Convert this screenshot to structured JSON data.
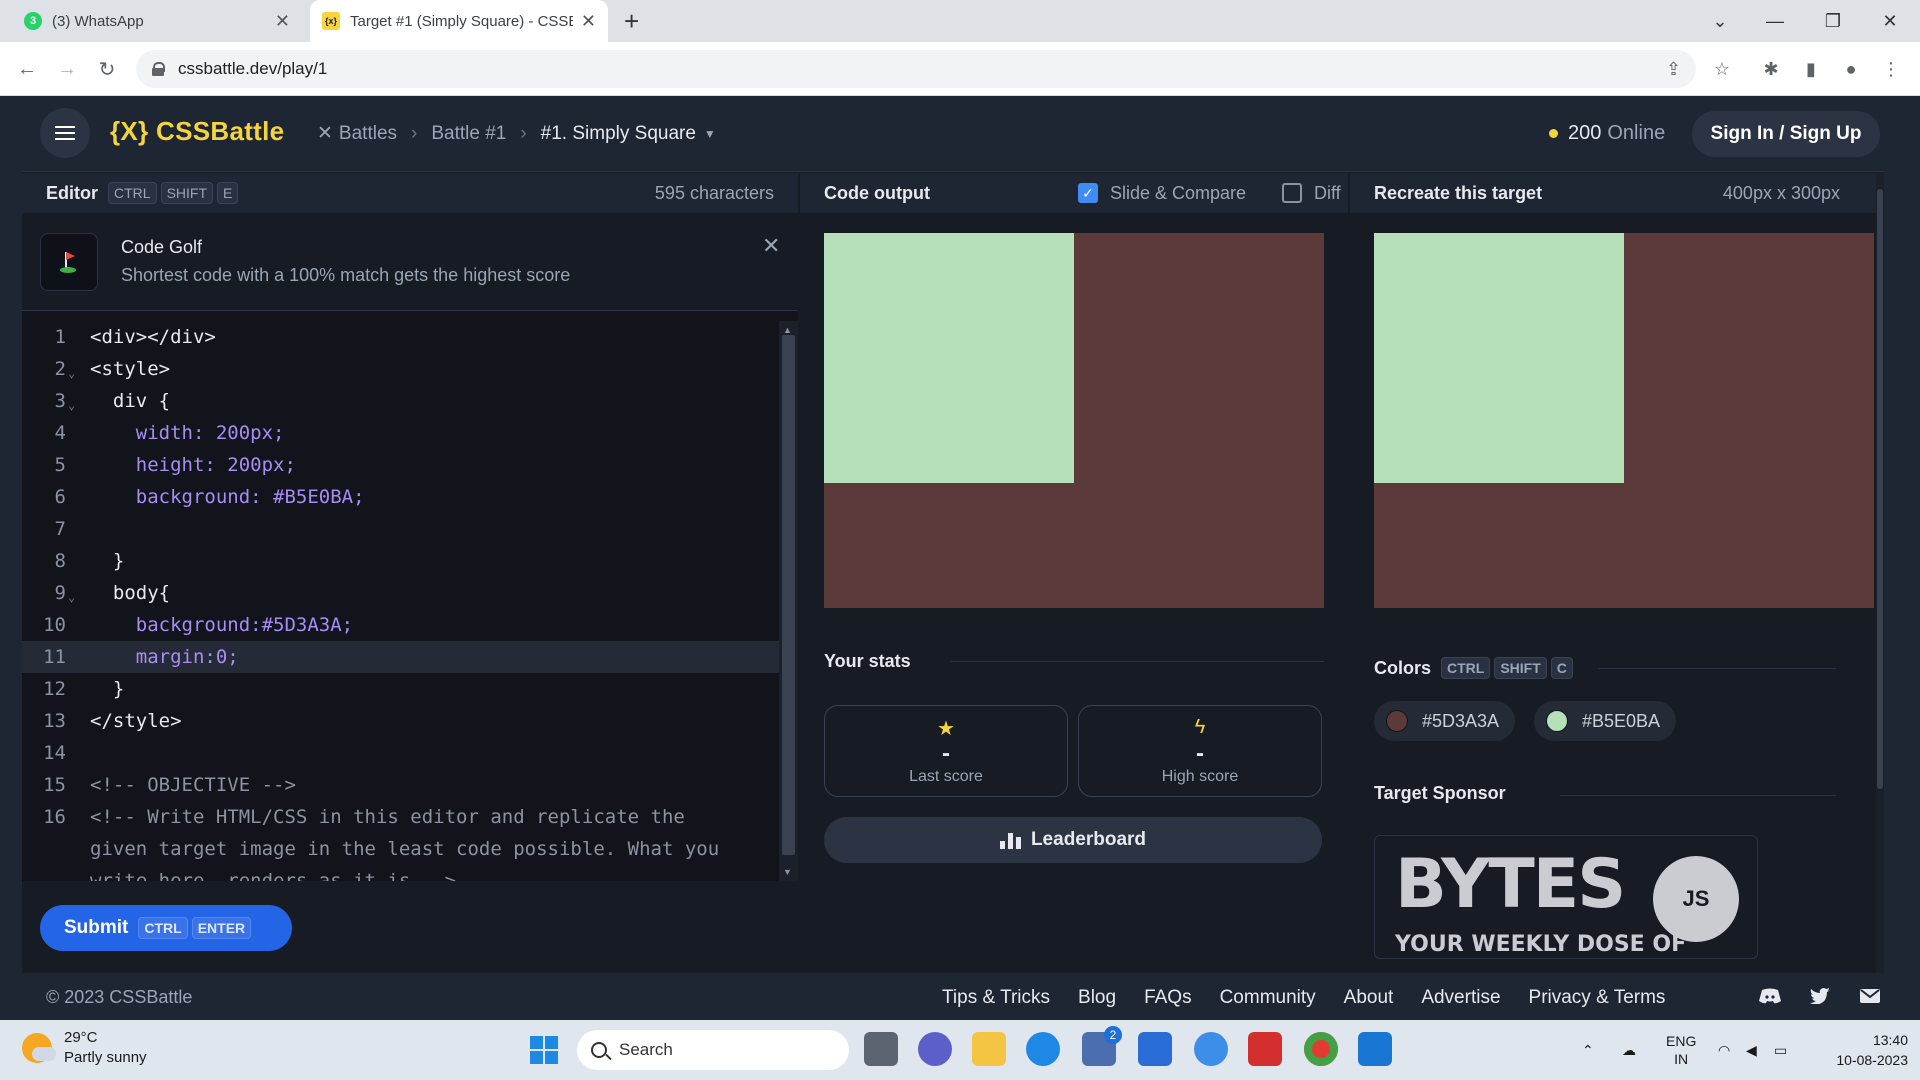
{
  "browser": {
    "tabs": [
      {
        "label": "(3) WhatsApp",
        "favicon_text": "3",
        "active": false
      },
      {
        "label": "Target #1 (Simply Square) - CSSB",
        "favicon_text": "{x}",
        "active": true
      }
    ],
    "new_tab": "+",
    "url": "cssbattle.dev/play/1"
  },
  "header": {
    "logo": "{X} CSSBattle",
    "breadcrumbs": [
      "Battles",
      "Battle #1",
      "#1. Simply Square"
    ],
    "online_count": "200",
    "online_label": "Online",
    "signin": "Sign In / Sign Up"
  },
  "editor": {
    "title": "Editor",
    "shortcut": [
      "CTRL",
      "SHIFT",
      "E"
    ],
    "chars": "595 characters",
    "golf_title": "Code Golf",
    "golf_desc": "Shortest code with a 100% match gets the highest score",
    "lines": [
      "<div></div>",
      "<style>",
      "  div {",
      "    width: 200px;",
      "    height: 200px;",
      "    background: #B5E0BA;",
      "",
      "  }",
      "  body{",
      "    background:#5D3A3A;",
      "    margin:0;",
      "  }",
      "</style>",
      "",
      "<!-- OBJECTIVE -->",
      "<!-- Write HTML/CSS in this editor and replicate the",
      "given target image in the least code possible. What you",
      "write here, renders as it is -->"
    ],
    "highlighted_line": 11,
    "submit": "Submit",
    "submit_shortcut": [
      "CTRL",
      "ENTER"
    ]
  },
  "output": {
    "title": "Code output",
    "slide_compare": "Slide & Compare",
    "slide_checked": true,
    "diff": "Diff",
    "diff_checked": false,
    "stats_title": "Your stats",
    "last_score_value": "-",
    "last_score_label": "Last score",
    "high_score_value": "-",
    "high_score_label": "High score",
    "leaderboard": "Leaderboard"
  },
  "target": {
    "title": "Recreate this target",
    "dimensions": "400px x 300px",
    "colors_title": "Colors",
    "colors_shortcut": [
      "CTRL",
      "SHIFT",
      "C"
    ],
    "colors": [
      {
        "hex": "#5D3A3A",
        "label": "#5D3A3A"
      },
      {
        "hex": "#B5E0BA",
        "label": "#B5E0BA"
      }
    ],
    "sponsor_title": "Target Sponsor",
    "sponsor_text_big": "BYTES",
    "sponsor_text_small": "YOUR WEEKLY DOSE OF",
    "sponsor_badge": "JS"
  },
  "footer": {
    "copyright": "© 2023 CSSBattle",
    "links": [
      "Tips & Tricks",
      "Blog",
      "FAQs",
      "Community",
      "About",
      "Advertise",
      "Privacy & Terms"
    ]
  },
  "taskbar": {
    "temp": "29°C",
    "weather": "Partly sunny",
    "search": "Search",
    "lang1": "ENG",
    "lang2": "IN",
    "time": "13:40",
    "date": "10-08-2023",
    "store_badge": "2"
  },
  "colors": {
    "accent_yellow": "#f6d43e",
    "target_bg": "#5D3A3A",
    "target_square": "#B5E0BA",
    "submit_blue": "#2464e6"
  }
}
